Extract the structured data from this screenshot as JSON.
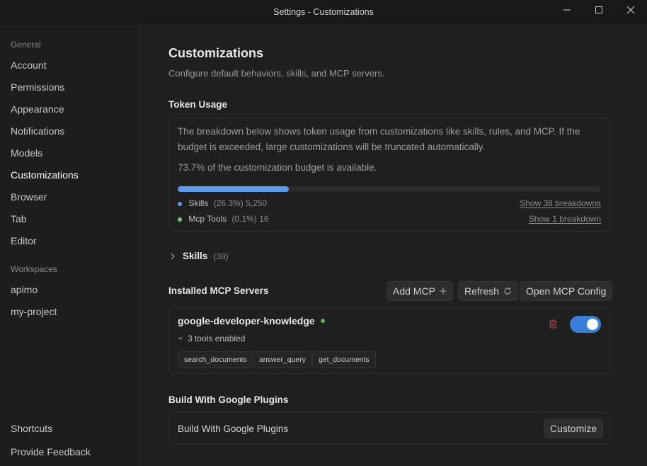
{
  "window": {
    "title": "Settings - Customizations",
    "minimize_icon": "minimize-icon",
    "maximize_icon": "maximize-icon",
    "close_icon": "close-icon"
  },
  "sidebar": {
    "general_header": "General",
    "general_items": [
      {
        "label": "Account"
      },
      {
        "label": "Permissions"
      },
      {
        "label": "Appearance"
      },
      {
        "label": "Notifications"
      },
      {
        "label": "Models"
      },
      {
        "label": "Customizations",
        "active": true
      },
      {
        "label": "Browser"
      },
      {
        "label": "Tab"
      },
      {
        "label": "Editor"
      }
    ],
    "workspaces_header": "Workspaces",
    "workspace_items": [
      {
        "label": "apimo"
      },
      {
        "label": "my-project"
      }
    ],
    "footer_items": [
      {
        "label": "Shortcuts"
      },
      {
        "label": "Provide Feedback"
      }
    ]
  },
  "page": {
    "title": "Customizations",
    "subtitle": "Configure default behaviors, skills, and MCP servers."
  },
  "token_usage": {
    "heading": "Token Usage",
    "description": "The breakdown below shows token usage from customizations like skills, rules, and MCP. If the budget is exceeded, large customizations will be truncated automatically.",
    "availability": "73.7% of the customization budget is available.",
    "used_fraction": 0.263,
    "rows": [
      {
        "name": "Skills",
        "percent": "(26.3%)",
        "count": "5,250",
        "link": "Show 38 breakdowns",
        "color": "#5b9cf0"
      },
      {
        "name": "Mcp Tools",
        "percent": "(0.1%)",
        "count": "16",
        "link": "Show 1 breakdown",
        "color": "#7cc57a"
      }
    ]
  },
  "skills_section": {
    "label": "Skills",
    "count": "(38)",
    "icon": "chevron-right-icon"
  },
  "mcp": {
    "heading": "Installed MCP Servers",
    "add_label": "Add MCP",
    "refresh_label": "Refresh",
    "open_config_label": "Open MCP Config",
    "server": {
      "name": "google-developer-knowledge",
      "status_color": "#5fb35f",
      "tools_summary": "3 tools enabled",
      "enabled": true,
      "tools": [
        "search_documents",
        "answer_query",
        "get_documents"
      ]
    }
  },
  "plugins": {
    "heading": "Build With Google Plugins",
    "row_label": "Build With Google Plugins",
    "customize_label": "Customize"
  }
}
